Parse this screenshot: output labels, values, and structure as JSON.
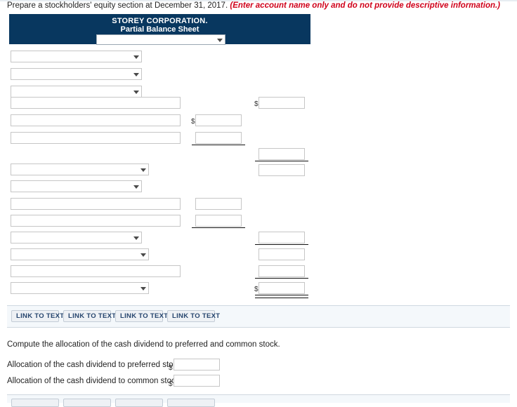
{
  "prompt": {
    "text": "Prepare a stockholders' equity section at December 31, 2017.",
    "emphasis": "(Enter account name only and do not provide descriptive information.)"
  },
  "statement": {
    "company": "STOREY CORPORATION.",
    "subtitle": "Partial Balance Sheet",
    "header_select": {
      "value": "",
      "placeholder": ""
    }
  },
  "rows": {
    "select_values": [
      "",
      "",
      "",
      "",
      "",
      "",
      "",
      "",
      ""
    ],
    "text_values": [
      "",
      "",
      "",
      "",
      "",
      ""
    ],
    "amount_values": [
      "",
      "",
      "",
      "",
      "",
      "",
      "",
      "",
      "",
      "",
      ""
    ],
    "currency_symbol": "$"
  },
  "link_buttons": [
    {
      "label": "LINK TO TEXT"
    },
    {
      "label": "LINK TO TEXT"
    },
    {
      "label": "LINK TO TEXT"
    },
    {
      "label": "LINK TO TEXT"
    }
  ],
  "question2": {
    "prompt": "Compute the allocation of the cash dividend to preferred and common stock.",
    "rows": [
      {
        "label": "Allocation of the cash dividend to preferred stock",
        "symbol": "$",
        "value": ""
      },
      {
        "label": "Allocation of the cash dividend to common stock",
        "symbol": "$",
        "value": ""
      }
    ]
  },
  "colors": {
    "header_navy": "#08375f",
    "emphasis_red": "#d0021b",
    "band_bg": "#f4f8fb",
    "button_text": "#26456e"
  }
}
